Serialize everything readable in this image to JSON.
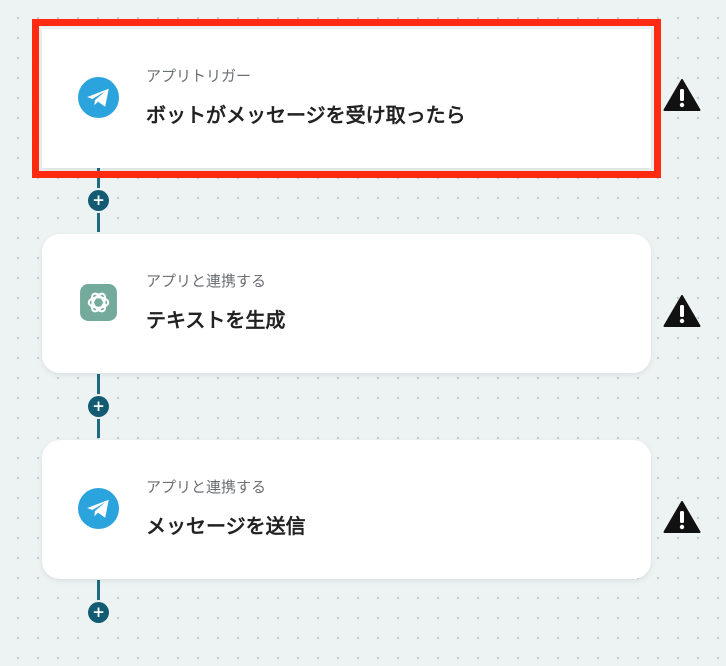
{
  "flow": {
    "steps": [
      {
        "subtitle": "アプリトリガー",
        "title": "ボットがメッセージを受け取ったら",
        "icon": "telegram-icon",
        "highlighted": true,
        "has_warning": true
      },
      {
        "subtitle": "アプリと連携する",
        "title": "テキストを生成",
        "icon": "chatgpt-icon",
        "highlighted": false,
        "has_warning": true
      },
      {
        "subtitle": "アプリと連携する",
        "title": "メッセージを送信",
        "icon": "telegram-icon",
        "highlighted": false,
        "has_warning": true
      }
    ],
    "add_button_label": "+"
  },
  "colors": {
    "highlight_border": "#ff2a12",
    "connector": "#1f6a80",
    "add_button": "#125b73",
    "telegram": "#2ba3dd",
    "chatgpt": "#74aa9c",
    "warning": "#111111"
  }
}
